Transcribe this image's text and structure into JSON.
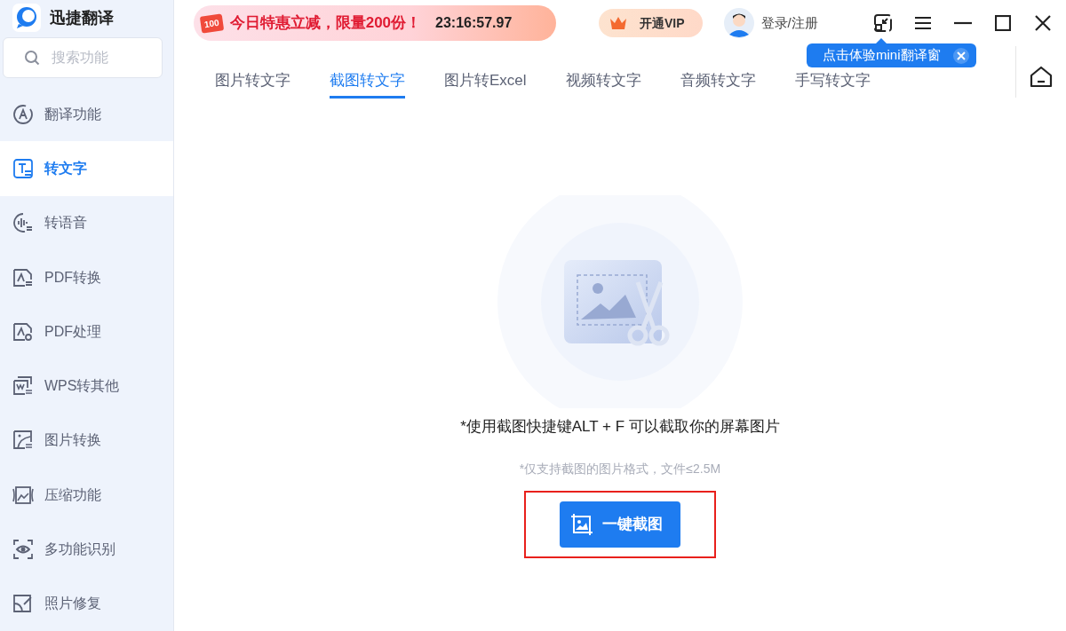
{
  "app": {
    "name": "迅捷翻译"
  },
  "search": {
    "placeholder": "搜索功能"
  },
  "sidebar": {
    "items": [
      {
        "label": "翻译功能",
        "selected": false
      },
      {
        "label": "转文字",
        "selected": true
      },
      {
        "label": "转语音",
        "selected": false
      },
      {
        "label": "PDF转换",
        "selected": false
      },
      {
        "label": "PDF处理",
        "selected": false
      },
      {
        "label": "WPS转其他",
        "selected": false
      },
      {
        "label": "图片转换",
        "selected": false
      },
      {
        "label": "压缩功能",
        "selected": false
      },
      {
        "label": "多功能识别",
        "selected": false
      },
      {
        "label": "照片修复",
        "selected": false
      }
    ]
  },
  "promo": {
    "badge": "100",
    "text": "今日特惠立减，限量200份！",
    "countdown": "23:16:57.97"
  },
  "vip_button": {
    "label": "开通VIP"
  },
  "login": {
    "label": "登录/注册"
  },
  "tooltip": {
    "text": "点击体验mini翻译窗"
  },
  "tabs": [
    {
      "label": "图片转文字",
      "selected": false
    },
    {
      "label": "截图转文字",
      "selected": true
    },
    {
      "label": "图片转Excel",
      "selected": false
    },
    {
      "label": "视频转文字",
      "selected": false
    },
    {
      "label": "音频转文字",
      "selected": false
    },
    {
      "label": "手写转文字",
      "selected": false
    }
  ],
  "main": {
    "hint": "*使用截图快捷键ALT + F 可以截取你的屏幕图片",
    "note": "*仅支持截图的图片格式，文件≤2.5M",
    "button": {
      "label": "一键截图",
      "highlighted": true
    }
  }
}
